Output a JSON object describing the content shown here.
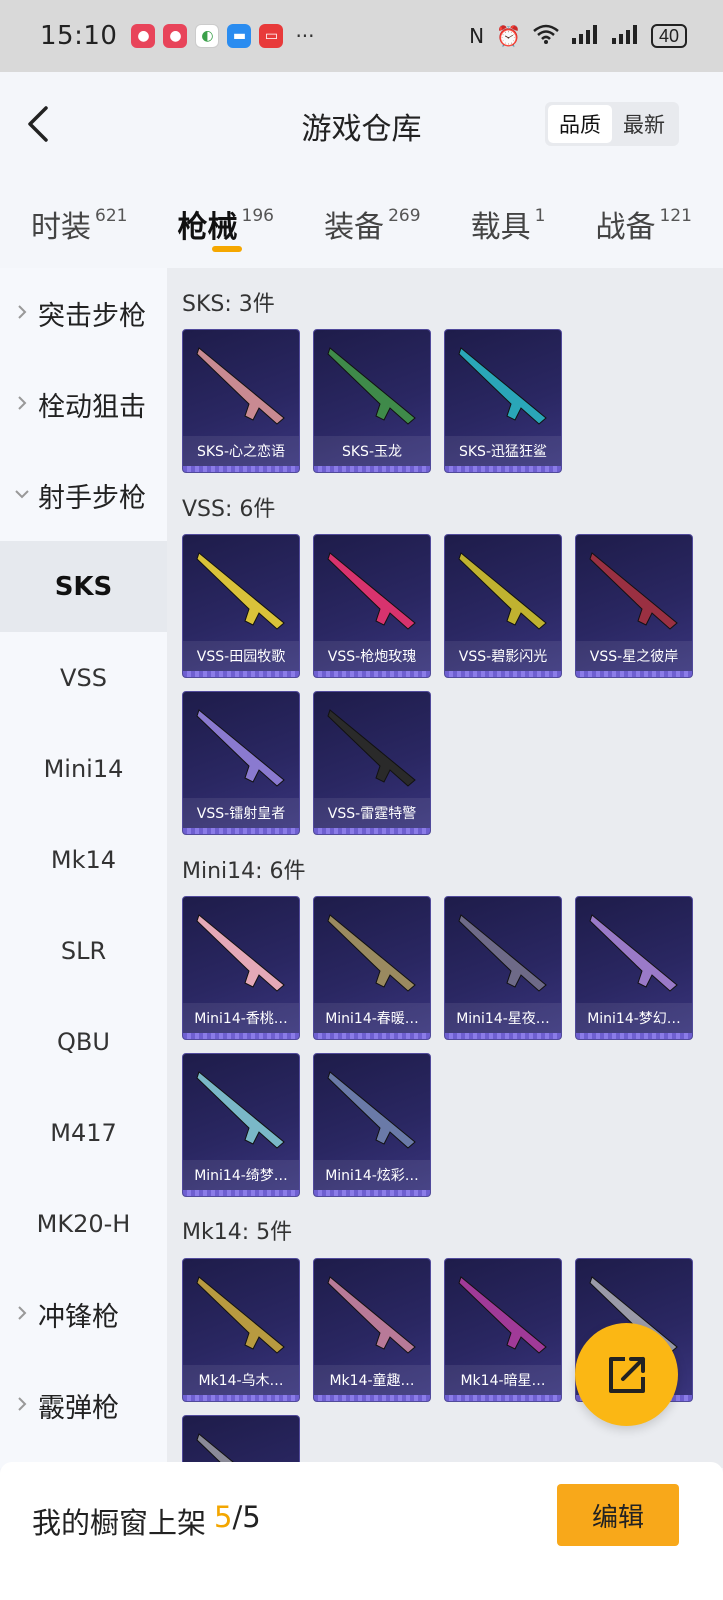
{
  "status_bar": {
    "time": "15:10",
    "dots": "···",
    "battery": "40"
  },
  "header": {
    "title": "游戏仓库",
    "sort": [
      "品质",
      "最新"
    ]
  },
  "tabs": [
    {
      "label": "时装",
      "count": "621"
    },
    {
      "label": "枪械",
      "count": "196"
    },
    {
      "label": "装备",
      "count": "269"
    },
    {
      "label": "载具",
      "count": "1"
    },
    {
      "label": "战备",
      "count": "121"
    }
  ],
  "sidebar": [
    {
      "label": "突击步枪",
      "group": true
    },
    {
      "label": "栓动狙击",
      "group": true
    },
    {
      "label": "射手步枪",
      "group": true,
      "expanded": true
    },
    {
      "label": "SKS",
      "active": true
    },
    {
      "label": "VSS"
    },
    {
      "label": "Mini14"
    },
    {
      "label": "Mk14"
    },
    {
      "label": "SLR"
    },
    {
      "label": "QBU"
    },
    {
      "label": "M417"
    },
    {
      "label": "MK20-H"
    },
    {
      "label": "冲锋枪",
      "group": true
    },
    {
      "label": "霰弹枪",
      "group": true
    }
  ],
  "sections": [
    {
      "title": "SKS: 3件",
      "items": [
        {
          "name": "SKS-心之恋语",
          "color": "#c98a92"
        },
        {
          "name": "SKS-玉龙",
          "color": "#3f8a4a"
        },
        {
          "name": "SKS-迅猛狂鲨",
          "color": "#2aa6b8"
        }
      ]
    },
    {
      "title": "VSS: 6件",
      "items": [
        {
          "name": "VSS-田园牧歌",
          "color": "#d9c23a"
        },
        {
          "name": "VSS-枪炮玫瑰",
          "color": "#d8336e"
        },
        {
          "name": "VSS-碧影闪光",
          "color": "#c0b230"
        },
        {
          "name": "VSS-星之彼岸",
          "color": "#9a3042"
        },
        {
          "name": "VSS-镭射皇者",
          "color": "#8a7ad0"
        },
        {
          "name": "VSS-雷霆特警",
          "color": "#2a2a2a"
        }
      ]
    },
    {
      "title": "Mini14: 6件",
      "items": [
        {
          "name": "Mini14-香桃…",
          "color": "#e5a9b8"
        },
        {
          "name": "Mini14-春暖…",
          "color": "#9a8a60"
        },
        {
          "name": "Mini14-星夜…",
          "color": "#6e6a88"
        },
        {
          "name": "Mini14-梦幻…",
          "color": "#9a7ac8"
        },
        {
          "name": "Mini14-绮梦…",
          "color": "#7ab8c8"
        },
        {
          "name": "Mini14-炫彩…",
          "color": "#6a7aa8"
        }
      ]
    },
    {
      "title": "Mk14: 5件",
      "items": [
        {
          "name": "Mk14-乌木…",
          "color": "#b89a40"
        },
        {
          "name": "Mk14-童趣…",
          "color": "#b87a98"
        },
        {
          "name": "Mk14-暗星…",
          "color": "#a03a98"
        },
        {
          "name": "",
          "color": "#9a9aa8"
        },
        {
          "name": "",
          "color": "#8a8a98"
        }
      ]
    }
  ],
  "bottom_bar": {
    "label": "我的橱窗上架",
    "count": "5",
    "total": "/5",
    "edit": "编辑"
  },
  "colors": {
    "accent": "#f5a700",
    "card_bg": "#2a2762",
    "fab": "#fbb714"
  }
}
